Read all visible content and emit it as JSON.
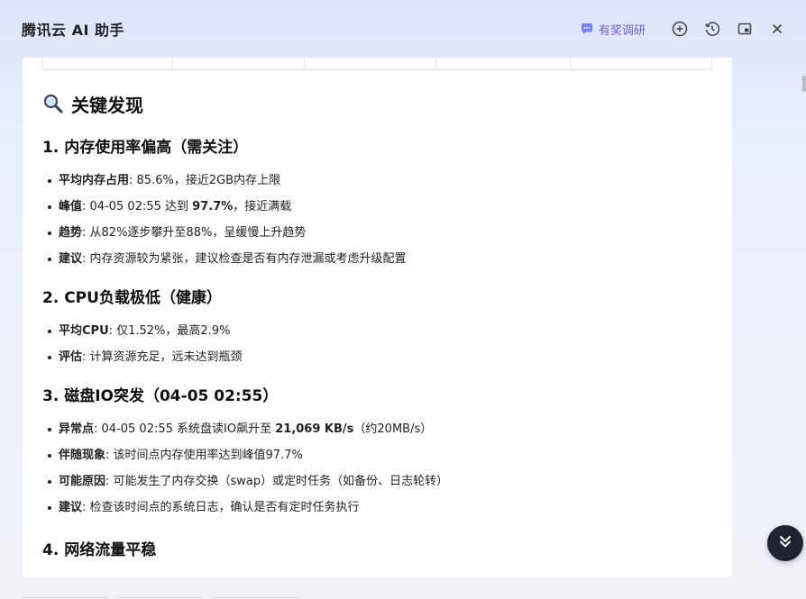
{
  "header": {
    "title": "腾讯云 AI 助手",
    "survey_label": "有奖调研",
    "icons": [
      "add-icon",
      "history-icon",
      "window-mode-icon",
      "close-icon"
    ]
  },
  "section": {
    "heading": "关键发现",
    "heading_icon": "magnifier-icon"
  },
  "findings": [
    {
      "title": "1. 内存使用率偏高（需关注）",
      "items": [
        {
          "label": "平均内存占用",
          "text": ": 85.6%，接近2GB内存上限"
        },
        {
          "label": "峰值",
          "text_pre": ": 04-05 02:55 达到 ",
          "strong": "97.7%",
          "text_post": "，接近满载"
        },
        {
          "label": "趋势",
          "text": ": 从82%逐步攀升至88%，呈缓慢上升趋势"
        },
        {
          "label": "建议",
          "text": ": 内存资源较为紧张，建议检查是否有内存泄漏或考虑升级配置"
        }
      ]
    },
    {
      "title": "2. CPU负载极低（健康）",
      "items": [
        {
          "label": "平均CPU",
          "text": ": 仅1.52%，最高2.9%"
        },
        {
          "label": "评估",
          "text": ": 计算资源充足，远未达到瓶颈"
        }
      ]
    },
    {
      "title": "3. 磁盘IO突发（04-05 02:55）",
      "items": [
        {
          "label": "异常点",
          "text_pre": ": 04-05 02:55 系统盘读IO飙升至 ",
          "strong": "21,069 KB/s",
          "text_post": "（约20MB/s）"
        },
        {
          "label": "伴随现象",
          "text": ": 该时间点内存使用率达到峰值97.7%"
        },
        {
          "label": "可能原因",
          "text": ": 可能发生了内存交换（swap）或定时任务（如备份、日志轮转）"
        },
        {
          "label": "建议",
          "text": ": 检查该时间点的系统日志，确认是否有定时任务执行"
        }
      ]
    },
    {
      "title": "4. 网络流量平稳",
      "items": []
    }
  ],
  "colors": {
    "accent": "#6d5ce8",
    "scroll_button": "#1e2430",
    "panel": "#ffffff"
  }
}
